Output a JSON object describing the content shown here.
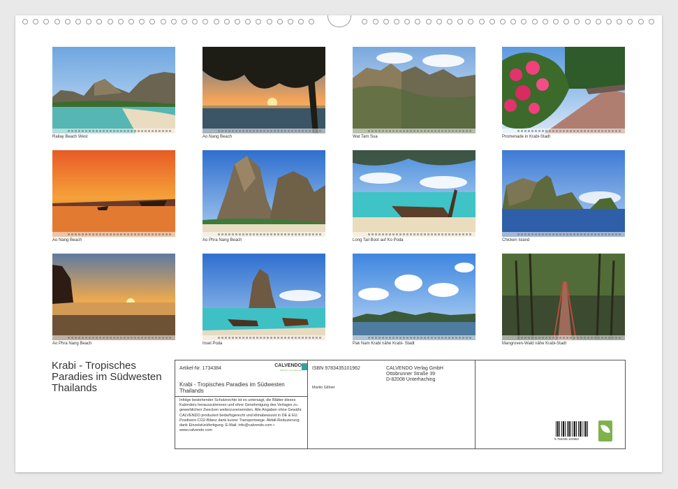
{
  "photos": [
    {
      "caption": "Railay Beach West",
      "scene": "bay-cliffs"
    },
    {
      "caption": "Ao Nang Beach",
      "scene": "sunset-tree"
    },
    {
      "caption": "Wat Tam Sua",
      "scene": "karst-mountains"
    },
    {
      "caption": "Promenade in Krabi-Stadt",
      "scene": "promenade"
    },
    {
      "caption": "Ao Nang Beach",
      "scene": "orange-sunset"
    },
    {
      "caption": "Ao Phra Nang Beach",
      "scene": "rock-beach"
    },
    {
      "caption": "Long Tail Boot auf Ko Poda",
      "scene": "longtail-boat"
    },
    {
      "caption": "Chicken Island",
      "scene": "island"
    },
    {
      "caption": "Ao Phra Nang Beach",
      "scene": "golden-sunset"
    },
    {
      "caption": "Insel Poda",
      "scene": "poda-boats"
    },
    {
      "caption": "Pak Nam Krabi nähe Krabi- Stadt",
      "scene": "clouds-river"
    },
    {
      "caption": "Mangroven-Wald nähe Krabi-Stadt",
      "scene": "mangrove"
    }
  ],
  "calendar_title": "Krabi - Tropisches Paradies im Südwesten Thailands",
  "info": {
    "article": "Artikel-Nr. 1734384",
    "brand": "CALVENDO",
    "brand_sub": "Kalender von Calvendo",
    "title": "Krabi - Tropisches Paradies im Südwesten Thailands",
    "legal": "Infolge bestehender Schutzrechte ist es untersagt, die Blätter dieses Kalenders herauszutrennen und ohne Genehmigung des Verlages zu gewerblichen Zwecken weiterzuverwenden. Alle Angaben ohne Gewähr. CALVENDO produziert bedarfsgerecht und klimabewusst in DE & EU. Positivere CO2-Bilanz dank kurzer Transportwege. Abfall-Reduzierung dank Einzelstückfertigung. E-Mail: info@calvendo.com • www.calvendo.com",
    "isbn": "ISBN 9783435101962",
    "author": "Martin Gillner",
    "publisher_lines": [
      "CALVENDO Verlag GmbH",
      "Ottobrunner Straße 39",
      "D-82008 Unterhaching"
    ],
    "barcode_text": "9 783435 101962"
  },
  "colors": {
    "sheet": "#ffffff",
    "background": "#e9e9e9",
    "text": "#333333",
    "fsc_green": "#7fb24a"
  }
}
